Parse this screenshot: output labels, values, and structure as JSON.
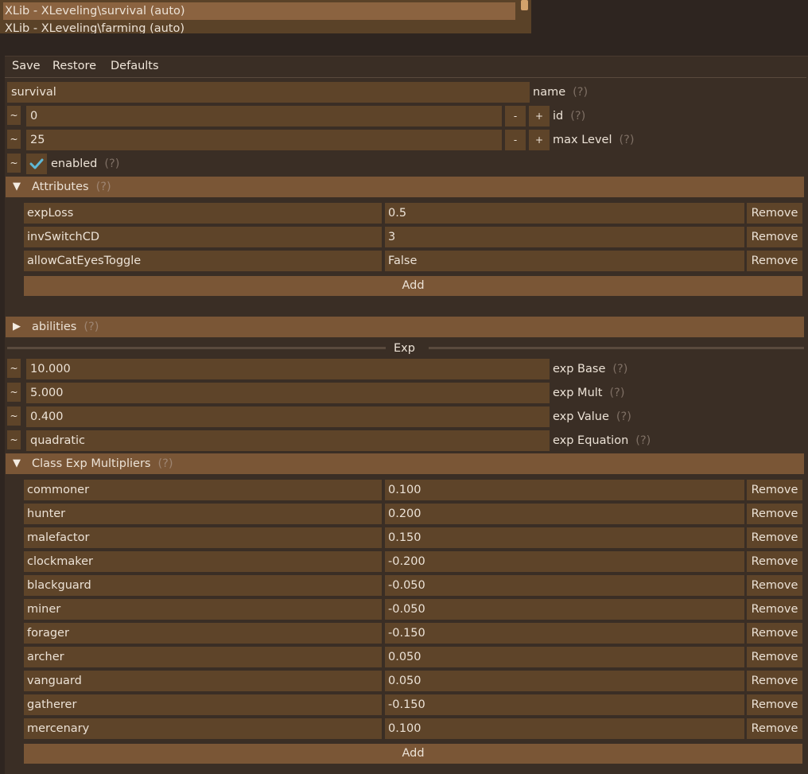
{
  "file_list": {
    "items": [
      "XLib - XLeveling\\survival (auto)",
      "XLib - XLeveling\\farming (auto)"
    ],
    "selected_index": 0
  },
  "menu": {
    "save": "Save",
    "restore": "Restore",
    "defaults": "Defaults"
  },
  "help_mark": "(?)",
  "tilde": "~",
  "minus": "-",
  "plus": "+",
  "fields": {
    "name": {
      "value": "survival",
      "label": "name"
    },
    "id": {
      "value": "0",
      "label": "id"
    },
    "max_level": {
      "value": "25",
      "label": "max Level"
    },
    "enabled": {
      "label": "enabled",
      "checked": true
    }
  },
  "attributes": {
    "header": "Attributes",
    "rows": [
      {
        "key": "expLoss",
        "value": "0.5"
      },
      {
        "key": "invSwitchCD",
        "value": "3"
      },
      {
        "key": "allowCatEyesToggle",
        "value": "False"
      }
    ],
    "remove_label": "Remove",
    "add_label": "Add"
  },
  "abilities": {
    "header": "abilities"
  },
  "exp_section": {
    "title": "Exp",
    "fields": [
      {
        "value": "10.000",
        "label": "exp Base"
      },
      {
        "value": "5.000",
        "label": "exp Mult"
      },
      {
        "value": "0.400",
        "label": "exp Value"
      },
      {
        "value": "quadratic",
        "label": "exp Equation"
      }
    ]
  },
  "class_multipliers": {
    "header": "Class Exp Multipliers",
    "rows": [
      {
        "key": "commoner",
        "value": "0.100"
      },
      {
        "key": "hunter",
        "value": "0.200"
      },
      {
        "key": "malefactor",
        "value": "0.150"
      },
      {
        "key": "clockmaker",
        "value": "-0.200"
      },
      {
        "key": "blackguard",
        "value": "-0.050"
      },
      {
        "key": "miner",
        "value": "-0.050"
      },
      {
        "key": "forager",
        "value": "-0.150"
      },
      {
        "key": "archer",
        "value": "0.050"
      },
      {
        "key": "vanguard",
        "value": "0.050"
      },
      {
        "key": "gatherer",
        "value": "-0.150"
      },
      {
        "key": "mercenary",
        "value": "0.100"
      }
    ],
    "remove_label": "Remove",
    "add_label": "Add"
  },
  "colors": {
    "accent": "#7a5636",
    "field": "#5e4429",
    "panel": "#3a2e25",
    "check": "#5fb8d6"
  }
}
